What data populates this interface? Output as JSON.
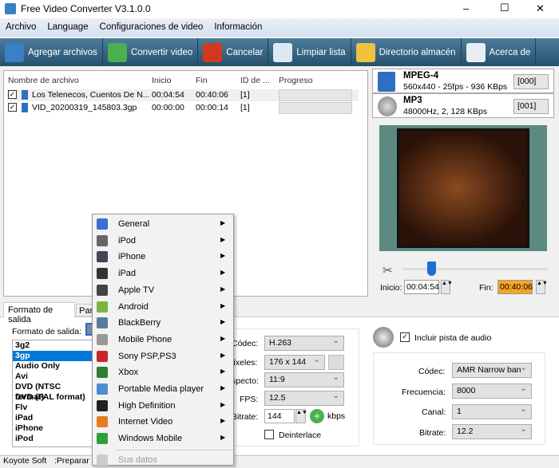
{
  "window": {
    "title": "Free Video Converter V3.1.0.0",
    "minimize": "–",
    "maximize": "☐",
    "close": "✕"
  },
  "menu": [
    "Archivo",
    "Language",
    "Configuraciones de video",
    "Información"
  ],
  "toolbar": [
    {
      "label": "Agregar archivos",
      "icon": "add-files-icon",
      "color": "#3b7fc4"
    },
    {
      "label": "Convertir video",
      "icon": "convert-icon",
      "color": "#4caf50"
    },
    {
      "label": "Cancelar",
      "icon": "cancel-icon",
      "color": "#d0391e"
    },
    {
      "label": "Limpiar lista",
      "icon": "clear-list-icon",
      "color": "#dce8f4"
    },
    {
      "label": "Directorio almacén",
      "icon": "folder-icon",
      "color": "#f0c040"
    },
    {
      "label": "Acerca de",
      "icon": "help-icon",
      "color": "#e8eef4"
    }
  ],
  "files": {
    "columns": [
      "Nombre de archivo",
      "Inicio",
      "Fin",
      "ID de ...",
      "Progreso"
    ],
    "rows": [
      {
        "checked": true,
        "name": "Los Telenecos, Cuentos De N...",
        "start": "00:04:54",
        "end": "00:40:06",
        "id": "[1]"
      },
      {
        "checked": true,
        "name": "VID_20200319_145803.3gp",
        "start": "00:00:00",
        "end": "00:00:14",
        "id": "[1]"
      }
    ]
  },
  "video_format": {
    "name": "MPEG-4",
    "detail": "560x440 - 25fps - 936 KBps",
    "track": "[000]"
  },
  "audio_format": {
    "name": "MP3",
    "detail": "48000Hz, 2, 128 KBps",
    "track": "[001]"
  },
  "trim": {
    "start_label": "Inicio:",
    "start": "00:04:54",
    "end_label": "Fin:",
    "end": "00:40:06",
    "slider_position": 0.2
  },
  "tabs": [
    "Formato de salida",
    "Par"
  ],
  "output": {
    "label": "Formato de salida:",
    "formats": [
      "3g2",
      "3gp",
      "Audio Only",
      "Avi",
      "DVD (NTSC format)",
      "DVD (PAL format)",
      "Flv",
      "iPad",
      "iPhone",
      "iPod"
    ],
    "selected": "3gp"
  },
  "video_settings": {
    "codec_label": "Códec:",
    "codec": "H.263",
    "pixels_label": "Píxeles:",
    "pixels": "176 x 144",
    "aspect_label": "Aspecto:",
    "aspect": "11:9",
    "fps_label": "FPS:",
    "fps": "12.5",
    "bitrate_label": "Bitrate:",
    "bitrate": "144",
    "bitrate_unit": "kbps",
    "deinterlace": "Deinterlace"
  },
  "audio_settings": {
    "include": "Incluir pista de audio",
    "codec_label": "Códec:",
    "codec": "AMR Narrow ban",
    "freq_label": "Frecuencia:",
    "freq": "8000",
    "channel_label": "Canal:",
    "channel": "1",
    "bitrate_label": "Bitrate:",
    "bitrate": "12.2"
  },
  "context_menu": {
    "items": [
      {
        "label": "General",
        "color": "#3b6fd0"
      },
      {
        "label": "iPod",
        "color": "#666"
      },
      {
        "label": "iPhone",
        "color": "#445"
      },
      {
        "label": "iPad",
        "color": "#333"
      },
      {
        "label": "Apple TV",
        "color": "#444"
      },
      {
        "label": "Android",
        "color": "#7cb342"
      },
      {
        "label": "BlackBerry",
        "color": "#5a7a9a"
      },
      {
        "label": "Mobile Phone",
        "color": "#999"
      },
      {
        "label": "Sony PSP,PS3",
        "color": "#c62828"
      },
      {
        "label": "Xbox",
        "color": "#2e7d32"
      },
      {
        "label": "Portable Media player",
        "color": "#4a8fcf"
      },
      {
        "label": "High Definition",
        "color": "#222"
      },
      {
        "label": "Internet Video",
        "color": "#e57c23"
      },
      {
        "label": "Windows Mobile",
        "color": "#2e9e3e"
      }
    ],
    "disabled": "Sus datos"
  },
  "status": {
    "left": "Koyote Soft",
    "right": ":Preparar"
  }
}
